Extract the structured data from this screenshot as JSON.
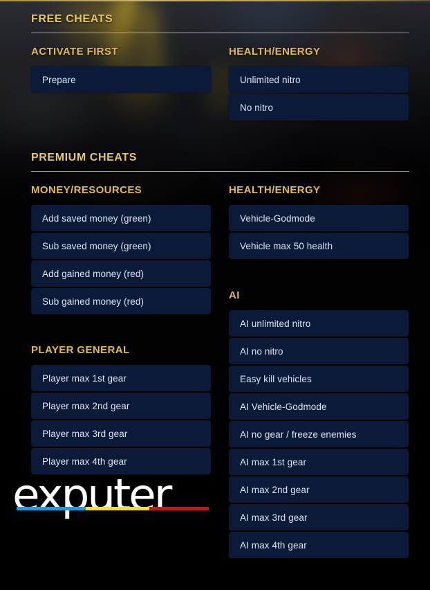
{
  "page": {
    "top_rule_color": "#caa95f",
    "pill_color": "#0c1a39",
    "heading_color": "#e9c95f",
    "subheading_color": "#e3bb4c",
    "pill_text_color": "#dfe6f2"
  },
  "sections": [
    {
      "title": "FREE CHEATS",
      "columns": [
        {
          "groups": [
            {
              "title": "ACTIVATE FIRST",
              "items": [
                "Prepare"
              ]
            }
          ]
        },
        {
          "groups": [
            {
              "title": "HEALTH/ENERGY",
              "items": [
                "Unlimited nitro",
                "No nitro"
              ]
            }
          ]
        }
      ]
    },
    {
      "title": "PREMIUM CHEATS",
      "columns": [
        {
          "groups": [
            {
              "title": "MONEY/RESOURCES",
              "items": [
                "Add saved money (green)",
                "Sub saved money (green)",
                "Add gained money (red)",
                "Sub gained money (red)"
              ]
            },
            {
              "title": "PLAYER GENERAL",
              "items": [
                "Player max 1st gear",
                "Player max 2nd gear",
                "Player max 3rd gear",
                "Player max 4th gear"
              ]
            }
          ]
        },
        {
          "groups": [
            {
              "title": "HEALTH/ENERGY",
              "items": [
                "Vehicle-Godmode",
                "Vehicle max 50 health"
              ]
            },
            {
              "title": "AI",
              "items": [
                "AI unlimited nitro",
                "AI no nitro",
                "Easy kill vehicles",
                "AI Vehicle-Godmode",
                "AI no gear / freeze enemies",
                "AI max 1st gear",
                "AI max 2nd gear",
                "AI max 3rd gear",
                "AI max 4th gear"
              ]
            }
          ]
        }
      ]
    }
  ],
  "logo": {
    "word": "exputer",
    "bar_colors": [
      "#2b97d2",
      "#f0e32b",
      "#ae2222"
    ]
  }
}
